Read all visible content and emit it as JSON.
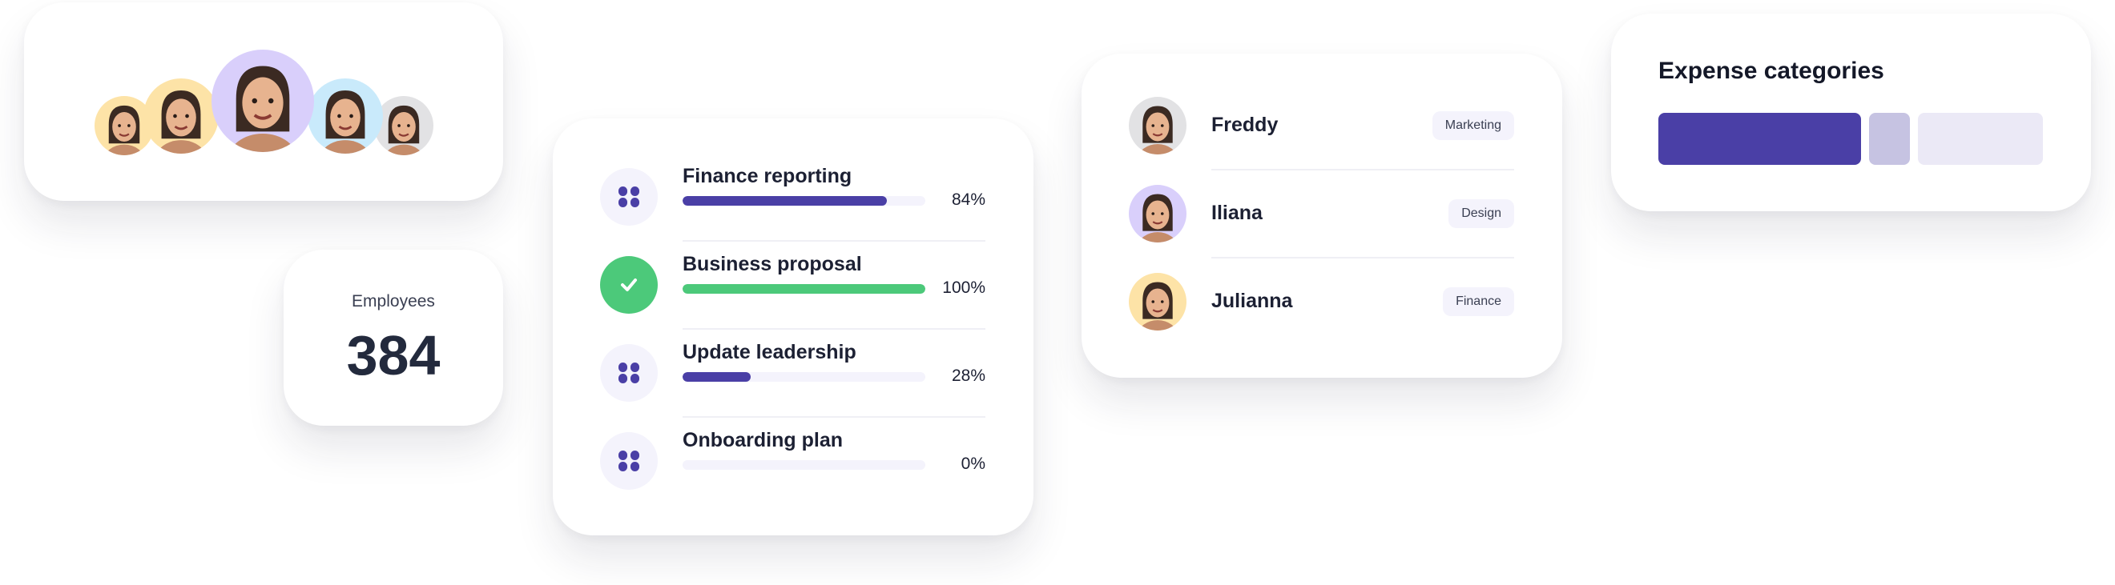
{
  "team_avatars": {
    "avatars": [
      {
        "name": "avatar-1",
        "bg": "#fde3a7"
      },
      {
        "name": "avatar-2",
        "bg": "#fde3a7"
      },
      {
        "name": "avatar-3",
        "bg": "#d9cffb"
      },
      {
        "name": "avatar-4",
        "bg": "#c9eafb"
      },
      {
        "name": "avatar-5",
        "bg": "#e2e2e4"
      }
    ]
  },
  "employees": {
    "label": "Employees",
    "count": "384"
  },
  "tasks": [
    {
      "title": "Finance reporting",
      "progress": 84,
      "percent_label": "84%",
      "icon": "grid-icon",
      "done": false
    },
    {
      "title": "Business proposal",
      "progress": 100,
      "percent_label": "100%",
      "icon": "check-icon",
      "done": true
    },
    {
      "title": "Update leadership",
      "progress": 28,
      "percent_label": "28%",
      "icon": "grid-icon",
      "done": false
    },
    {
      "title": "Onboarding plan",
      "progress": 0,
      "percent_label": "0%",
      "icon": "grid-icon",
      "done": false
    }
  ],
  "people": [
    {
      "name": "Freddy",
      "department": "Marketing",
      "avatar_bg": "#e2e2e4"
    },
    {
      "name": "Iliana",
      "department": "Design",
      "avatar_bg": "#d9cffb"
    },
    {
      "name": "Julianna",
      "department": "Finance",
      "avatar_bg": "#fde3a7"
    }
  ],
  "expenses": {
    "title": "Expense categories",
    "segments": [
      {
        "share": 55,
        "color": "#4a3fa6"
      },
      {
        "share": 11,
        "color": "#c6c3e2"
      },
      {
        "share": 34,
        "color": "#ebe9f6"
      }
    ]
  },
  "colors": {
    "accent": "#4a3fa6",
    "success": "#4cc97a",
    "track": "#f4f3fc"
  }
}
